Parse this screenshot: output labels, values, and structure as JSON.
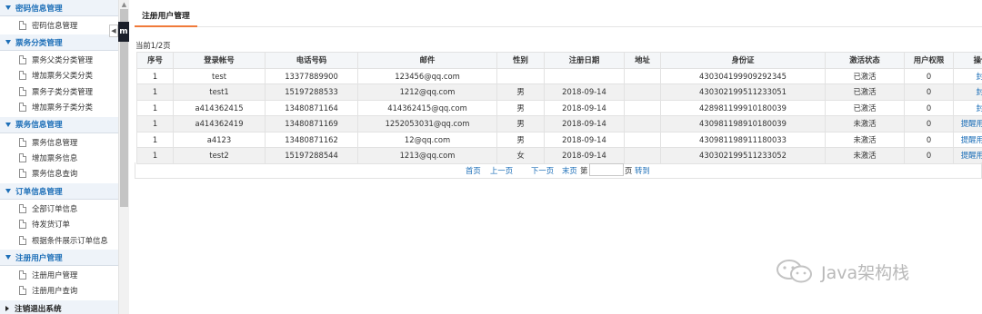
{
  "sidebar": {
    "dark_tab_label": "m",
    "groups": [
      {
        "label": "密码信息管理",
        "items": [
          "密码信息管理"
        ]
      },
      {
        "label": "票务分类管理",
        "items": [
          "票务父类分类管理",
          "增加票务父类分类",
          "票务子类分类管理",
          "增加票务子类分类"
        ]
      },
      {
        "label": "票务信息管理",
        "items": [
          "票务信息管理",
          "增加票务信息",
          "票务信息查询"
        ]
      },
      {
        "label": "订单信息管理",
        "items": [
          "全部订单信息",
          "待发货订单",
          "根据条件展示订单信息"
        ]
      },
      {
        "label": "注册用户管理",
        "items": [
          "注册用户管理",
          "注册用户查询"
        ]
      }
    ],
    "logout_label": "注销退出系统"
  },
  "main": {
    "tab_label": "注册用户管理",
    "page_info": "当前1/2页",
    "columns": [
      "序号",
      "登录帐号",
      "电话号码",
      "邮件",
      "性别",
      "注册日期",
      "地址",
      "身份证",
      "激活状态",
      "用户权限",
      "操作"
    ],
    "rows": [
      [
        "1",
        "test",
        "13377889900",
        "123456@qq.com",
        "",
        "",
        "",
        "430304199909292345",
        "已激活",
        "0",
        "封禁账户"
      ],
      [
        "1",
        "test1",
        "15197288533",
        "1212@qq.com",
        "男",
        "2018-09-14",
        "",
        "430302199511233051",
        "已激活",
        "0",
        "封禁账户"
      ],
      [
        "1",
        "a414362415",
        "13480871164",
        "414362415@qq.com",
        "男",
        "2018-09-14",
        "",
        "428981199910180039",
        "已激活",
        "0",
        "封禁账户"
      ],
      [
        "1",
        "a414362419",
        "13480871169",
        "1252053031@qq.com",
        "男",
        "2018-09-14",
        "",
        "430981198910180039",
        "未激活",
        "0",
        "提醒用户激活"
      ],
      [
        "1",
        "a4123",
        "13480871162",
        "12@qq.com",
        "男",
        "2018-09-14",
        "",
        "430981198911180033",
        "未激活",
        "0",
        "提醒用户激活"
      ],
      [
        "1",
        "test2",
        "15197288544",
        "1213@qq.com",
        "女",
        "2018-09-14",
        "",
        "430302199511233052",
        "未激活",
        "0",
        "提醒用户激活"
      ]
    ],
    "pager": {
      "first": "首页",
      "prev": "上一页",
      "next": "下一页",
      "last": "末页",
      "page_prefix": "第",
      "page_suffix": "页",
      "go": "转到"
    }
  },
  "watermark": {
    "text": "Java架构栈"
  },
  "colors": {
    "accent": "#1d6fb8",
    "tab_underline": "#f07a3a",
    "header_bg": "#eef3f9"
  }
}
